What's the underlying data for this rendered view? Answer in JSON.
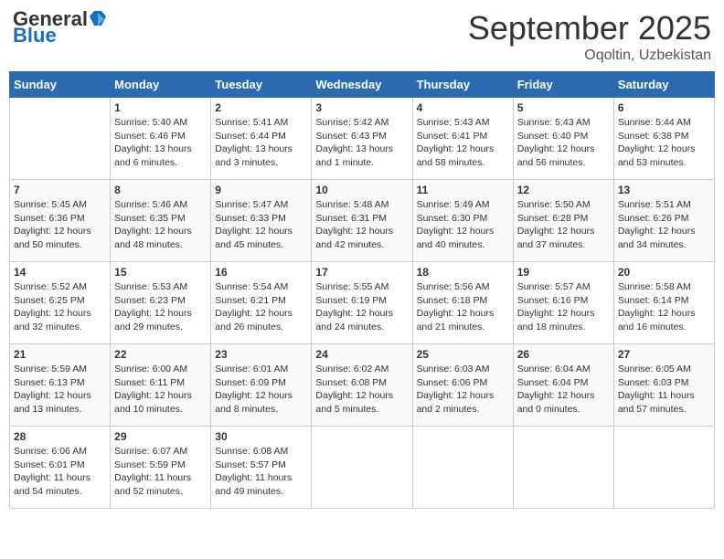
{
  "header": {
    "logo_general": "General",
    "logo_blue": "Blue",
    "month": "September 2025",
    "location": "Oqoltin, Uzbekistan"
  },
  "days_of_week": [
    "Sunday",
    "Monday",
    "Tuesday",
    "Wednesday",
    "Thursday",
    "Friday",
    "Saturday"
  ],
  "weeks": [
    [
      {
        "num": "",
        "info": ""
      },
      {
        "num": "1",
        "info": "Sunrise: 5:40 AM\nSunset: 6:46 PM\nDaylight: 13 hours\nand 6 minutes."
      },
      {
        "num": "2",
        "info": "Sunrise: 5:41 AM\nSunset: 6:44 PM\nDaylight: 13 hours\nand 3 minutes."
      },
      {
        "num": "3",
        "info": "Sunrise: 5:42 AM\nSunset: 6:43 PM\nDaylight: 13 hours\nand 1 minute."
      },
      {
        "num": "4",
        "info": "Sunrise: 5:43 AM\nSunset: 6:41 PM\nDaylight: 12 hours\nand 58 minutes."
      },
      {
        "num": "5",
        "info": "Sunrise: 5:43 AM\nSunset: 6:40 PM\nDaylight: 12 hours\nand 56 minutes."
      },
      {
        "num": "6",
        "info": "Sunrise: 5:44 AM\nSunset: 6:38 PM\nDaylight: 12 hours\nand 53 minutes."
      }
    ],
    [
      {
        "num": "7",
        "info": "Sunrise: 5:45 AM\nSunset: 6:36 PM\nDaylight: 12 hours\nand 50 minutes."
      },
      {
        "num": "8",
        "info": "Sunrise: 5:46 AM\nSunset: 6:35 PM\nDaylight: 12 hours\nand 48 minutes."
      },
      {
        "num": "9",
        "info": "Sunrise: 5:47 AM\nSunset: 6:33 PM\nDaylight: 12 hours\nand 45 minutes."
      },
      {
        "num": "10",
        "info": "Sunrise: 5:48 AM\nSunset: 6:31 PM\nDaylight: 12 hours\nand 42 minutes."
      },
      {
        "num": "11",
        "info": "Sunrise: 5:49 AM\nSunset: 6:30 PM\nDaylight: 12 hours\nand 40 minutes."
      },
      {
        "num": "12",
        "info": "Sunrise: 5:50 AM\nSunset: 6:28 PM\nDaylight: 12 hours\nand 37 minutes."
      },
      {
        "num": "13",
        "info": "Sunrise: 5:51 AM\nSunset: 6:26 PM\nDaylight: 12 hours\nand 34 minutes."
      }
    ],
    [
      {
        "num": "14",
        "info": "Sunrise: 5:52 AM\nSunset: 6:25 PM\nDaylight: 12 hours\nand 32 minutes."
      },
      {
        "num": "15",
        "info": "Sunrise: 5:53 AM\nSunset: 6:23 PM\nDaylight: 12 hours\nand 29 minutes."
      },
      {
        "num": "16",
        "info": "Sunrise: 5:54 AM\nSunset: 6:21 PM\nDaylight: 12 hours\nand 26 minutes."
      },
      {
        "num": "17",
        "info": "Sunrise: 5:55 AM\nSunset: 6:19 PM\nDaylight: 12 hours\nand 24 minutes."
      },
      {
        "num": "18",
        "info": "Sunrise: 5:56 AM\nSunset: 6:18 PM\nDaylight: 12 hours\nand 21 minutes."
      },
      {
        "num": "19",
        "info": "Sunrise: 5:57 AM\nSunset: 6:16 PM\nDaylight: 12 hours\nand 18 minutes."
      },
      {
        "num": "20",
        "info": "Sunrise: 5:58 AM\nSunset: 6:14 PM\nDaylight: 12 hours\nand 16 minutes."
      }
    ],
    [
      {
        "num": "21",
        "info": "Sunrise: 5:59 AM\nSunset: 6:13 PM\nDaylight: 12 hours\nand 13 minutes."
      },
      {
        "num": "22",
        "info": "Sunrise: 6:00 AM\nSunset: 6:11 PM\nDaylight: 12 hours\nand 10 minutes."
      },
      {
        "num": "23",
        "info": "Sunrise: 6:01 AM\nSunset: 6:09 PM\nDaylight: 12 hours\nand 8 minutes."
      },
      {
        "num": "24",
        "info": "Sunrise: 6:02 AM\nSunset: 6:08 PM\nDaylight: 12 hours\nand 5 minutes."
      },
      {
        "num": "25",
        "info": "Sunrise: 6:03 AM\nSunset: 6:06 PM\nDaylight: 12 hours\nand 2 minutes."
      },
      {
        "num": "26",
        "info": "Sunrise: 6:04 AM\nSunset: 6:04 PM\nDaylight: 12 hours\nand 0 minutes."
      },
      {
        "num": "27",
        "info": "Sunrise: 6:05 AM\nSunset: 6:03 PM\nDaylight: 11 hours\nand 57 minutes."
      }
    ],
    [
      {
        "num": "28",
        "info": "Sunrise: 6:06 AM\nSunset: 6:01 PM\nDaylight: 11 hours\nand 54 minutes."
      },
      {
        "num": "29",
        "info": "Sunrise: 6:07 AM\nSunset: 5:59 PM\nDaylight: 11 hours\nand 52 minutes."
      },
      {
        "num": "30",
        "info": "Sunrise: 6:08 AM\nSunset: 5:57 PM\nDaylight: 11 hours\nand 49 minutes."
      },
      {
        "num": "",
        "info": ""
      },
      {
        "num": "",
        "info": ""
      },
      {
        "num": "",
        "info": ""
      },
      {
        "num": "",
        "info": ""
      }
    ]
  ]
}
